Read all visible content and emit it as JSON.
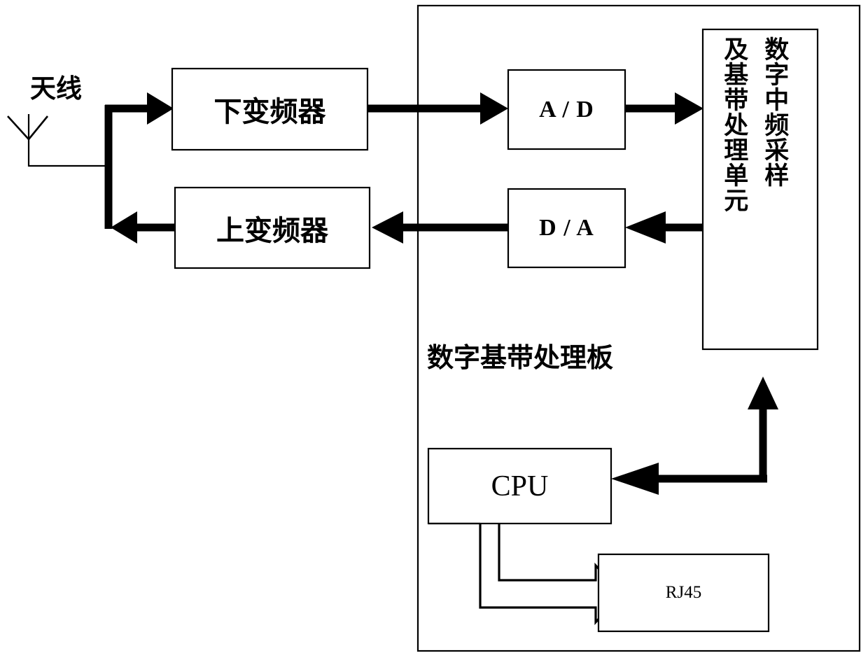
{
  "diagram": {
    "title": "数字基带处理板",
    "enclosure_label": "数字基带处理板",
    "background_color": "#ffffff",
    "line_color": "#000000",
    "nodes": {
      "antenna": {
        "label": "天线",
        "icon": "antenna-icon"
      },
      "down_converter": {
        "label": "下变频器"
      },
      "up_converter": {
        "label": "上变频器"
      },
      "adc": {
        "label": "A / D"
      },
      "dac": {
        "label": "D / A"
      },
      "processing_unit": {
        "label_line1": "数字中频采样",
        "label_line2": "及基带处理单元"
      },
      "cpu": {
        "label": "CPU"
      },
      "rj45": {
        "label": "RJ45"
      }
    },
    "edges": [
      {
        "name": "antenna-to-down-converter",
        "from": "antenna",
        "to": "down_converter",
        "style": "solid-thick"
      },
      {
        "name": "down-converter-to-adc",
        "from": "down_converter",
        "to": "adc",
        "style": "solid-thick"
      },
      {
        "name": "adc-to-processing-unit",
        "from": "adc",
        "to": "processing_unit",
        "style": "solid-thick"
      },
      {
        "name": "processing-unit-to-dac",
        "from": "processing_unit",
        "to": "dac",
        "style": "solid-thick"
      },
      {
        "name": "dac-to-up-converter",
        "from": "dac",
        "to": "up_converter",
        "style": "solid-thick"
      },
      {
        "name": "up-converter-to-antenna",
        "from": "up_converter",
        "to": "antenna",
        "style": "solid-thick"
      },
      {
        "name": "processing-unit-to-cpu",
        "from": "processing_unit",
        "to": "cpu",
        "style": "solid-thick"
      },
      {
        "name": "cpu-to-rj45",
        "from": "cpu",
        "to": "rj45",
        "style": "hollow-block-arrow"
      }
    ]
  }
}
